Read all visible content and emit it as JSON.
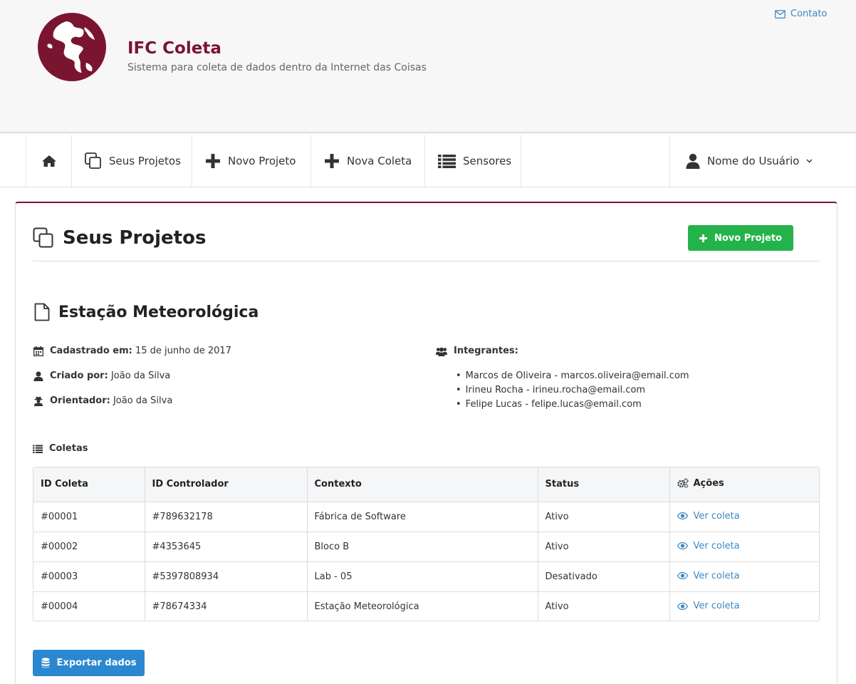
{
  "header": {
    "title": "IFC Coleta",
    "subtitle": "Sistema para coleta de dados dentro da Internet das Coisas",
    "contact_label": "Contato"
  },
  "nav": {
    "items": [
      {
        "label": "",
        "icon": "home-icon"
      },
      {
        "label": "Seus Projetos",
        "icon": "copy-icon"
      },
      {
        "label": "Novo Projeto",
        "icon": "plus-icon"
      },
      {
        "label": "Nova Coleta",
        "icon": "plus-icon"
      },
      {
        "label": "Sensores",
        "icon": "list-icon"
      }
    ],
    "user_label": "Nome do Usuário"
  },
  "page": {
    "title": "Seus Projetos",
    "new_project_button": "Novo Projeto"
  },
  "project": {
    "title": "Estação Meteorológica",
    "registered_label": "Cadastrado em:",
    "registered_value": "15 de junho de 2017",
    "created_label": "Criado por:",
    "created_value": "João da Silva",
    "advisor_label": "Orientador:",
    "advisor_value": "João da Silva",
    "members_label": "Integrantes:",
    "members": [
      "Marcos de Oliveira - marcos.oliveira@email.com",
      "Irineu Rocha - irineu.rocha@email.com",
      "Felipe Lucas - felipe.lucas@email.com"
    ]
  },
  "coletas": {
    "label": "Coletas",
    "columns": [
      "ID Coleta",
      "ID Controlador",
      "Contexto",
      "Status",
      "Ações"
    ],
    "rows": [
      {
        "id": "#00001",
        "controller": "#789632178",
        "context": "Fábrica de Software",
        "status": "Ativo",
        "action": "Ver coleta"
      },
      {
        "id": "#00002",
        "controller": "#4353645",
        "context": "Bloco B",
        "status": "Ativo",
        "action": "Ver coleta"
      },
      {
        "id": "#00003",
        "controller": "#5397808934",
        "context": "Lab - 05",
        "status": "Desativado",
        "action": "Ver coleta"
      },
      {
        "id": "#00004",
        "controller": "#78674334",
        "context": "Estação Meteorológica",
        "status": "Ativo",
        "action": "Ver coleta"
      }
    ],
    "export_button": "Exportar dados"
  },
  "colors": {
    "brand": "#7a1530",
    "link": "#3b88c3",
    "success": "#24b34b",
    "primary": "#2a87d0"
  }
}
